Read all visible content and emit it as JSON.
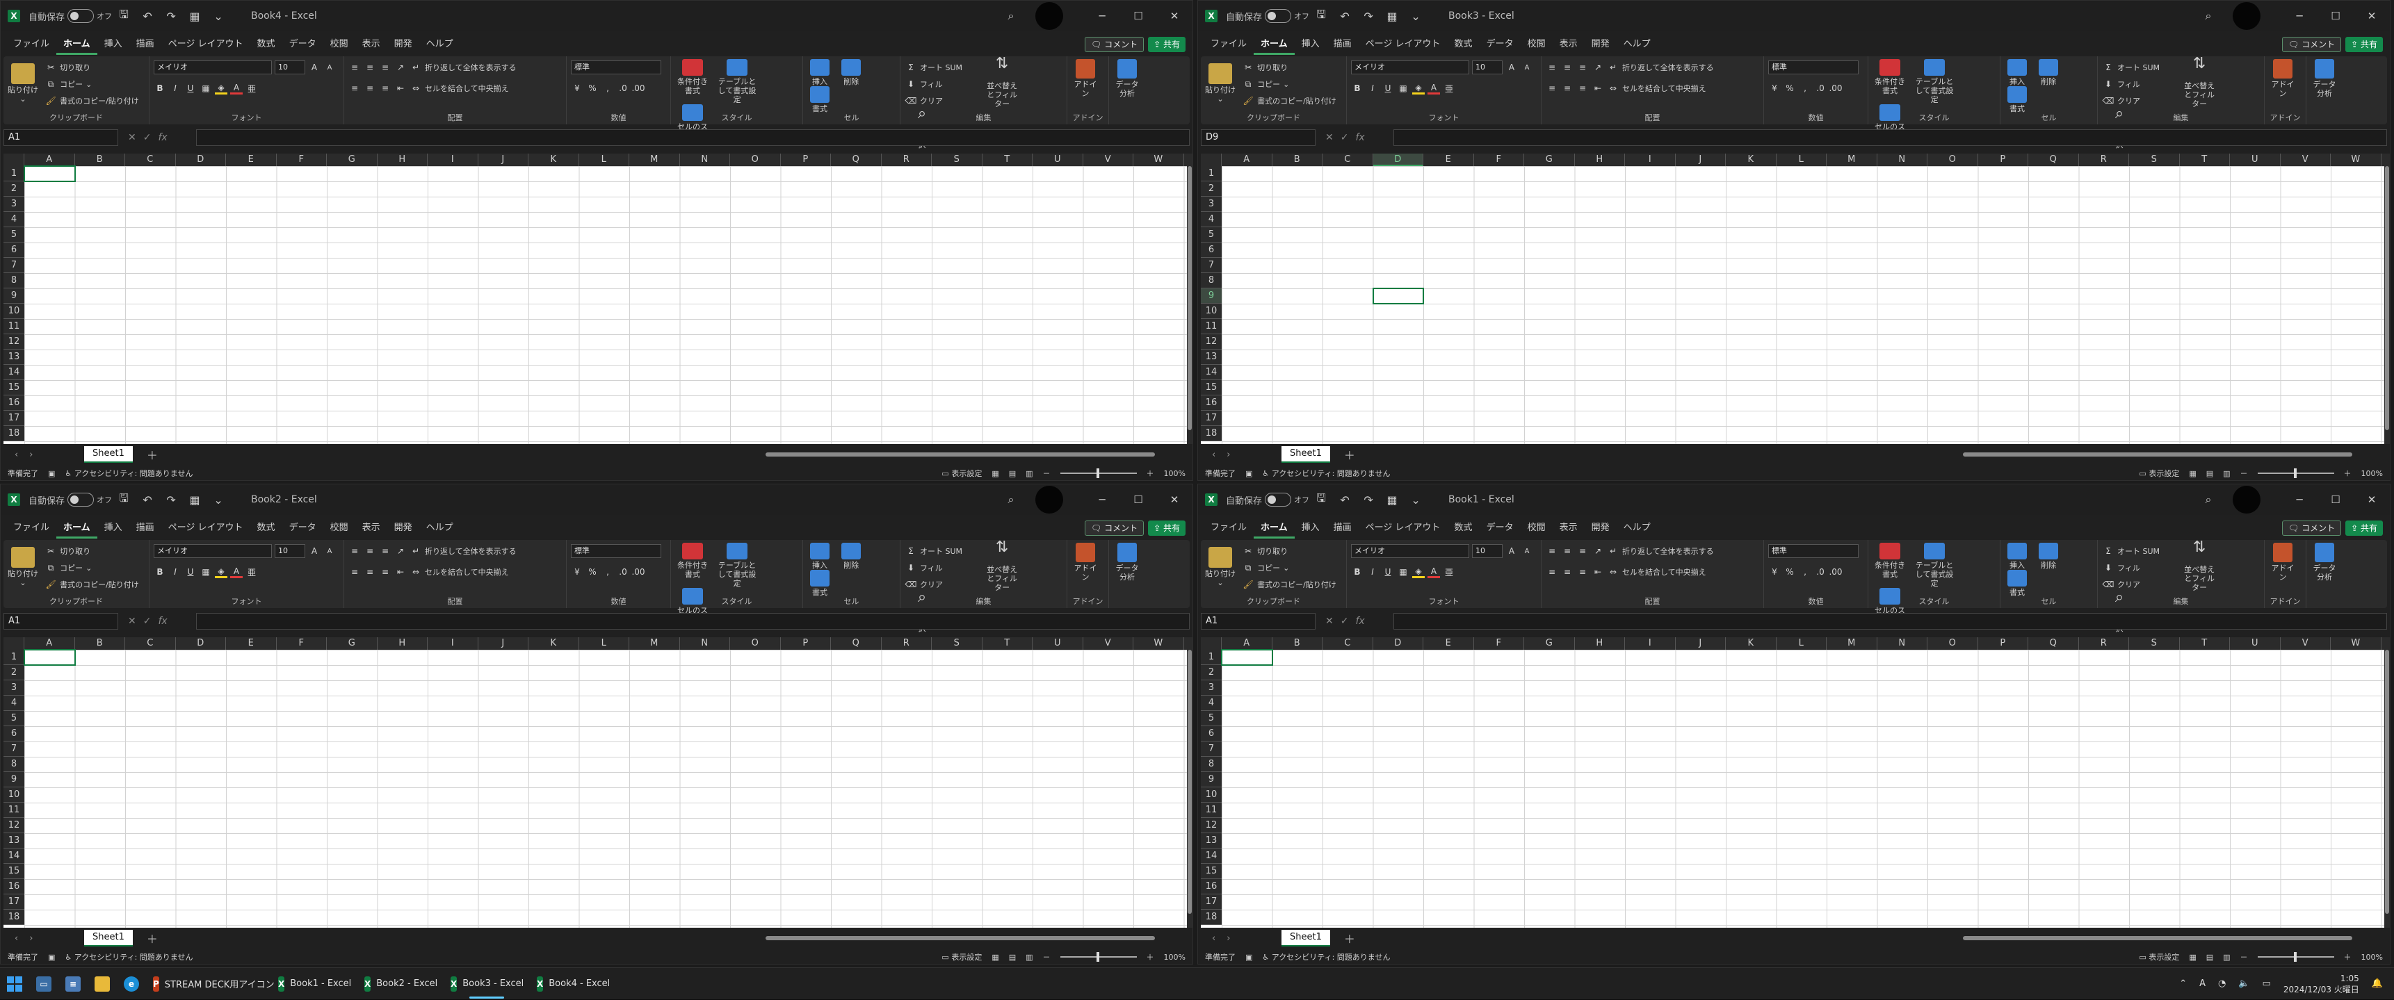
{
  "ribbon": {
    "tabs": [
      "ファイル",
      "ホーム",
      "挿入",
      "描画",
      "ページ レイアウト",
      "数式",
      "データ",
      "校閲",
      "表示",
      "開発",
      "ヘルプ"
    ],
    "active_tab": "ホーム",
    "comment_label": "コメント",
    "share_label": "共有",
    "autosave_label": "自動保存",
    "autosave_state": "オフ",
    "clipboard": {
      "paste": "貼り付け",
      "cut": "切り取り",
      "copy": "コピー",
      "format_painter": "書式のコピー/貼り付け",
      "label": "クリップボード"
    },
    "font": {
      "name": "メイリオ",
      "size": "10",
      "label": "フォント",
      "bold": "B",
      "italic": "I",
      "underline": "U"
    },
    "alignment": {
      "wrap": "折り返して全体を表示する",
      "merge": "セルを結合して中央揃え",
      "label": "配置"
    },
    "number": {
      "format": "標準",
      "label": "数値"
    },
    "styles": {
      "conditional": "条件付き書式",
      "table": "テーブルとして書式設定",
      "cell": "セルのスタイル",
      "label": "スタイル"
    },
    "cells": {
      "insert": "挿入",
      "delete": "削除",
      "format": "書式",
      "label": "セル"
    },
    "editing": {
      "autosum": "オート SUM",
      "fill": "フィル",
      "clear": "クリア",
      "sort": "並べ替えとフィルター",
      "find": "検索と選択",
      "label": "編集"
    },
    "addins": {
      "addin": "アドイン",
      "label": "アドイン"
    },
    "analyze": {
      "label": "データ分析"
    }
  },
  "columns": [
    "A",
    "B",
    "C",
    "D",
    "E",
    "F",
    "G",
    "H",
    "I",
    "J",
    "K",
    "L",
    "M",
    "N",
    "O",
    "P",
    "Q",
    "R",
    "S",
    "T",
    "U",
    "V",
    "W"
  ],
  "rows": [
    "1",
    "2",
    "3",
    "4",
    "5",
    "6",
    "7",
    "8",
    "9",
    "10",
    "11",
    "12",
    "13",
    "14",
    "15",
    "16",
    "17",
    "18"
  ],
  "windows": [
    {
      "title": "Book4 - Excel",
      "namebox": "A1",
      "sheet": "Sheet1",
      "selected_col": "",
      "selected_row": ""
    },
    {
      "title": "Book3 - Excel",
      "namebox": "D9",
      "sheet": "Sheet1",
      "selected_col": "D",
      "selected_row": "9"
    },
    {
      "title": "Book2 - Excel",
      "namebox": "A1",
      "sheet": "Sheet1",
      "selected_col": "",
      "selected_row": ""
    },
    {
      "title": "Book1 - Excel",
      "namebox": "A1",
      "sheet": "Sheet1",
      "selected_col": "",
      "selected_row": ""
    }
  ],
  "status": {
    "ready": "準備完了",
    "accessibility": "アクセシビリティ: 問題ありません",
    "display_settings": "表示設定",
    "zoom": "100%"
  },
  "taskbar": {
    "items": [
      {
        "label": "STREAM DECK用アイコン",
        "icon": "powerpoint-icon",
        "color": "#c43e1c"
      },
      {
        "label": "Book1 - Excel",
        "icon": "excel-icon",
        "color": "#107c41"
      },
      {
        "label": "Book2 - Excel",
        "icon": "excel-icon",
        "color": "#107c41"
      },
      {
        "label": "Book3 - Excel",
        "icon": "excel-icon",
        "color": "#107c41"
      },
      {
        "label": "Book4 - Excel",
        "icon": "excel-icon",
        "color": "#107c41"
      }
    ],
    "ime": "A",
    "time": "1:05",
    "date": "2024/12/03 火曜日"
  },
  "colors": {
    "accent": "#107c41",
    "share": "#138a4c",
    "taskbar_active": "#60cdff"
  }
}
